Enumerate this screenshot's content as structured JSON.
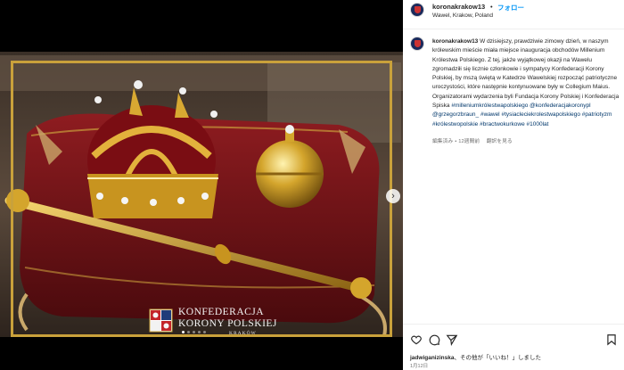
{
  "post": {
    "username": "koronakrakow13",
    "dot": "•",
    "follow_label": "フォロー",
    "location": "Wawel, Krakow, Poland"
  },
  "caption": {
    "username": "koronakrakow13",
    "text": "W dzisiejszy, prawdziwie zimowy dzień, w naszym królewskim mieście miała miejsce inauguracja obchodów Millenium Królestwa Polskiego. Z tej, jakże wyjątkowej okazji na Wawelu zgromadziłi się licznie członkowie i sympatycy Konfederacji Korony Polskiej, by mszą świętą w Katedrze Wawelskiej rozpocząć patriotyczne uroczystości, które następnie kontynuowane były w Collegium Maius. Organizatorami wydarzenia byli Fundacja Korony Polskiej i Konfederacja Spiska",
    "hashtags": [
      "#milleniumkrólestwapolskiego",
      "@konfederacjakoronypl",
      "@grzegorzbraun_",
      "#wawel",
      "#tysiacleciekrolestwapolskiego",
      "#patriotyzm",
      "#królestwopolskie",
      "#bractwokurkowe",
      "#1000lat"
    ],
    "edited": "編集済み",
    "time": "12週間前",
    "translate": "翻訳を見る"
  },
  "media": {
    "logo_line1": "KONFEDERACJA",
    "logo_line2": "KORONY POLSKIEJ",
    "logo_line3": "KRAKÓW",
    "next_icon": "chevron-right-icon",
    "carousel_count": 5,
    "carousel_active": 1
  },
  "actions": {
    "icons": [
      "heart-icon",
      "comment-icon",
      "share-icon",
      "bookmark-icon"
    ],
    "likes_user": "jadwiganizinska",
    "likes_text": "、その他が「いいね！」しました",
    "date": "1月12日"
  },
  "colors": {
    "link": "#00376b",
    "follow": "#0095f6",
    "frame_gold": "#c9a13b",
    "cushion": "#7a1418"
  }
}
